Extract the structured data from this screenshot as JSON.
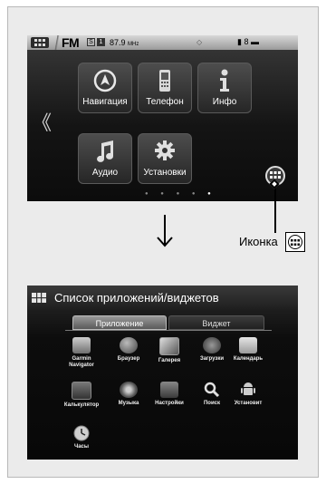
{
  "home_screen": {
    "status_bar": {
      "source": "FM",
      "box_a": "S",
      "box_b": "1",
      "frequency": "87.9",
      "frequency_unit": "MHz",
      "diamond": "◇",
      "right_icons": "▮ 8 ▬"
    },
    "tiles": [
      {
        "label": "Навигация",
        "icon": "navigation-icon"
      },
      {
        "label": "Телефон",
        "icon": "phone-icon"
      },
      {
        "label": "Инфо",
        "icon": "info-icon"
      },
      {
        "label": "Аудио",
        "icon": "music-note-icon"
      },
      {
        "label": "Установки",
        "icon": "gear-icon"
      }
    ],
    "nav_left": "《",
    "page_dots": "● ● ● ●"
  },
  "callout": {
    "label": "Иконка"
  },
  "apps_screen": {
    "title": "Список приложений/виджетов",
    "tabs": [
      "Приложение",
      "Виджет"
    ],
    "apps": [
      {
        "label": "Garmin Navigator",
        "icon": "garmin-icon"
      },
      {
        "label": "Браузер",
        "icon": "browser-icon"
      },
      {
        "label": "Галерея",
        "icon": "gallery-icon"
      },
      {
        "label": "Загрузки",
        "icon": "download-icon"
      },
      {
        "label": "Календарь",
        "icon": "calendar-icon"
      },
      {
        "label": "Калькулятор",
        "icon": "calculator-icon"
      },
      {
        "label": "Музыка",
        "icon": "music-icon"
      },
      {
        "label": "Настройки",
        "icon": "settings-icon"
      },
      {
        "label": "Поиск",
        "icon": "search-icon"
      },
      {
        "label": "Установит",
        "icon": "android-icon"
      },
      {
        "label": "Часы",
        "icon": "clock-icon"
      }
    ]
  },
  "colors": {
    "screen_dark": "#141414",
    "status_bar": "#bdbdbd",
    "tab_active": "#7a7a7a",
    "page_background": "#ebebeb"
  }
}
